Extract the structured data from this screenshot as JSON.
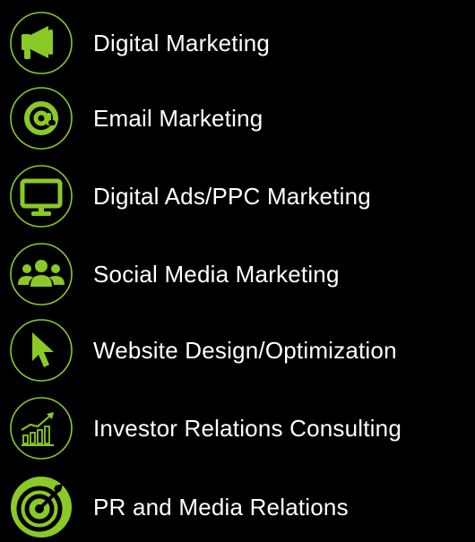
{
  "colors": {
    "background": "#000000",
    "accent": "#8ac926",
    "ring": "#8ac926",
    "text": "#ffffff"
  },
  "services": [
    {
      "label": "Digital Marketing",
      "icon": "megaphone-icon"
    },
    {
      "label": "Email Marketing",
      "icon": "at-sign-icon"
    },
    {
      "label": "Digital Ads/PPC Marketing",
      "icon": "monitor-icon"
    },
    {
      "label": "Social Media Marketing",
      "icon": "users-group-icon"
    },
    {
      "label": "Website Design/Optimization",
      "icon": "cursor-pointer-icon"
    },
    {
      "label": "Investor Relations Consulting",
      "icon": "growth-chart-icon"
    },
    {
      "label": "PR and Media Relations",
      "icon": "target-dart-icon"
    }
  ]
}
